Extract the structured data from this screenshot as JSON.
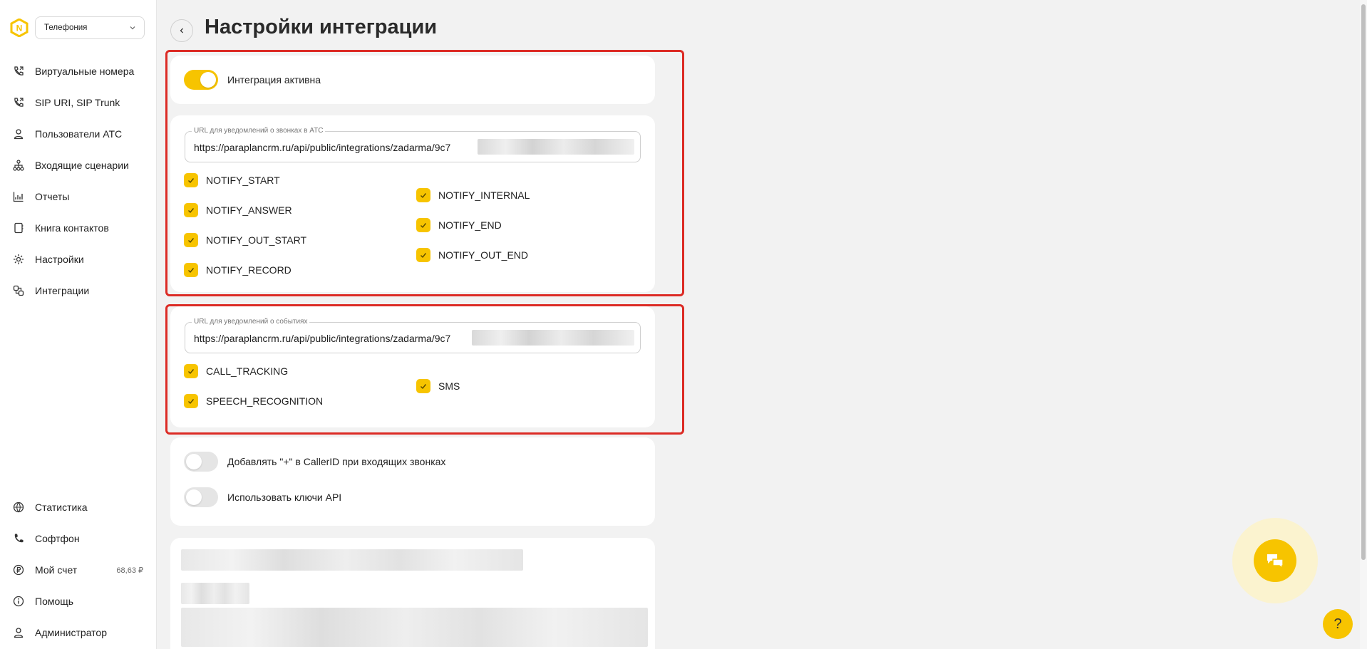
{
  "sidebar": {
    "product_select": "Телефония",
    "nav": [
      {
        "label": "Виртуальные номера",
        "icon": "phone-forward-icon"
      },
      {
        "label": "SIP URI, SIP Trunk",
        "icon": "phone-forward-icon"
      },
      {
        "label": "Пользователи АТС",
        "icon": "user-icon"
      },
      {
        "label": "Входящие сценарии",
        "icon": "flow-tree-icon"
      },
      {
        "label": "Отчеты",
        "icon": "chart-icon"
      },
      {
        "label": "Книга контактов",
        "icon": "contacts-book-icon"
      },
      {
        "label": "Настройки",
        "icon": "gear-icon"
      },
      {
        "label": "Интеграции",
        "icon": "integrations-icon"
      }
    ],
    "bottom_nav": [
      {
        "label": "Статистика",
        "icon": "globe-icon"
      },
      {
        "label": "Софтфон",
        "icon": "phone-icon"
      },
      {
        "label": "Мой счет",
        "icon": "ruble-icon",
        "balance": "68,63 ₽"
      },
      {
        "label": "Помощь",
        "icon": "info-icon"
      },
      {
        "label": "Администратор",
        "icon": "user-icon"
      }
    ]
  },
  "page": {
    "title": "Настройки интеграции"
  },
  "integration": {
    "active_label": "Интеграция активна",
    "active": true
  },
  "pbx_notifications": {
    "url_legend": "URL для уведомлений о звонках в АТС",
    "url_value": "https://paraplancrm.ru/api/public/integrations/zadarma/9c7",
    "events_left": [
      "NOTIFY_START",
      "NOTIFY_ANSWER",
      "NOTIFY_OUT_START",
      "NOTIFY_RECORD"
    ],
    "events_right": [
      "NOTIFY_INTERNAL",
      "NOTIFY_END",
      "NOTIFY_OUT_END"
    ]
  },
  "event_notifications": {
    "url_legend": "URL для уведомлений о событиях",
    "url_value": "https://paraplancrm.ru/api/public/integrations/zadarma/9c7",
    "events_left": [
      "CALL_TRACKING",
      "SPEECH_RECOGNITION"
    ],
    "events_right": [
      "SMS"
    ]
  },
  "options": {
    "plus_callerid_label": "Добавлять \"+\" в CallerID при входящих звонках",
    "plus_callerid": false,
    "api_keys_label": "Использовать ключи API",
    "api_keys": false
  },
  "widgets": {
    "help_label": "?"
  },
  "colors": {
    "accent": "#f7c400",
    "highlight": "#dc2b25",
    "background": "#f2f2f2"
  }
}
